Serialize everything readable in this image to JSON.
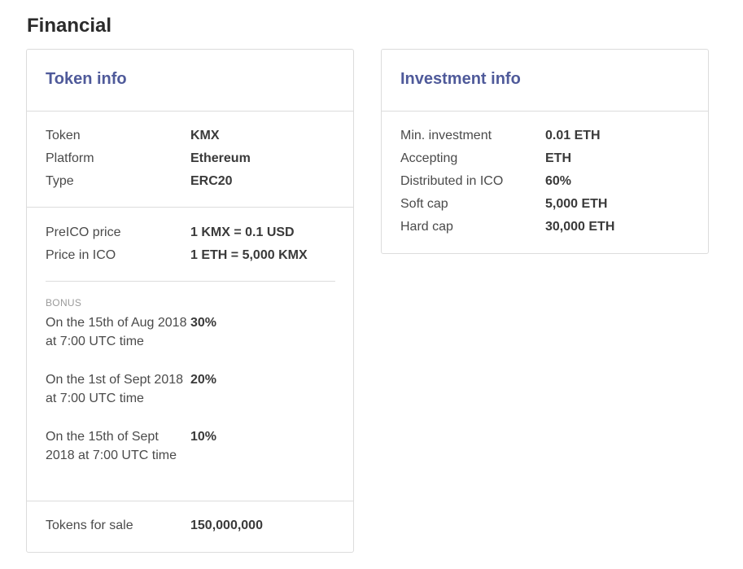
{
  "page": {
    "title": "Financial"
  },
  "token_info": {
    "title": "Token info",
    "details": [
      {
        "label": "Token",
        "value": "KMX"
      },
      {
        "label": "Platform",
        "value": "Ethereum"
      },
      {
        "label": "Type",
        "value": "ERC20"
      }
    ],
    "prices": [
      {
        "label": "PreICO price",
        "value": "1 KMX = 0.1 USD"
      },
      {
        "label": "Price in ICO",
        "value": "1 ETH = 5,000 KMX"
      }
    ],
    "bonus": {
      "label": "BONUS",
      "items": [
        {
          "when": "On the 15th of Aug 2018 at 7:00 UTC time",
          "percent": "30%"
        },
        {
          "when": "On the 1st of Sept 2018 at 7:00 UTC time",
          "percent": "20%"
        },
        {
          "when": "On the 15th of Sept 2018 at 7:00 UTC time",
          "percent": "10%"
        }
      ]
    },
    "sale": {
      "label": "Tokens for sale",
      "value": "150,000,000"
    }
  },
  "investment_info": {
    "title": "Investment info",
    "rows": [
      {
        "label": "Min. investment",
        "value": "0.01 ETH"
      },
      {
        "label": "Accepting",
        "value": "ETH"
      },
      {
        "label": "Distributed in ICO",
        "value": "60%"
      },
      {
        "label": "Soft cap",
        "value": "5,000 ETH"
      },
      {
        "label": "Hard cap",
        "value": "30,000 ETH"
      }
    ]
  },
  "colors": {
    "card_title": "#4f5a9a",
    "border": "#dcdcdc",
    "muted": "#9b9b9b"
  }
}
